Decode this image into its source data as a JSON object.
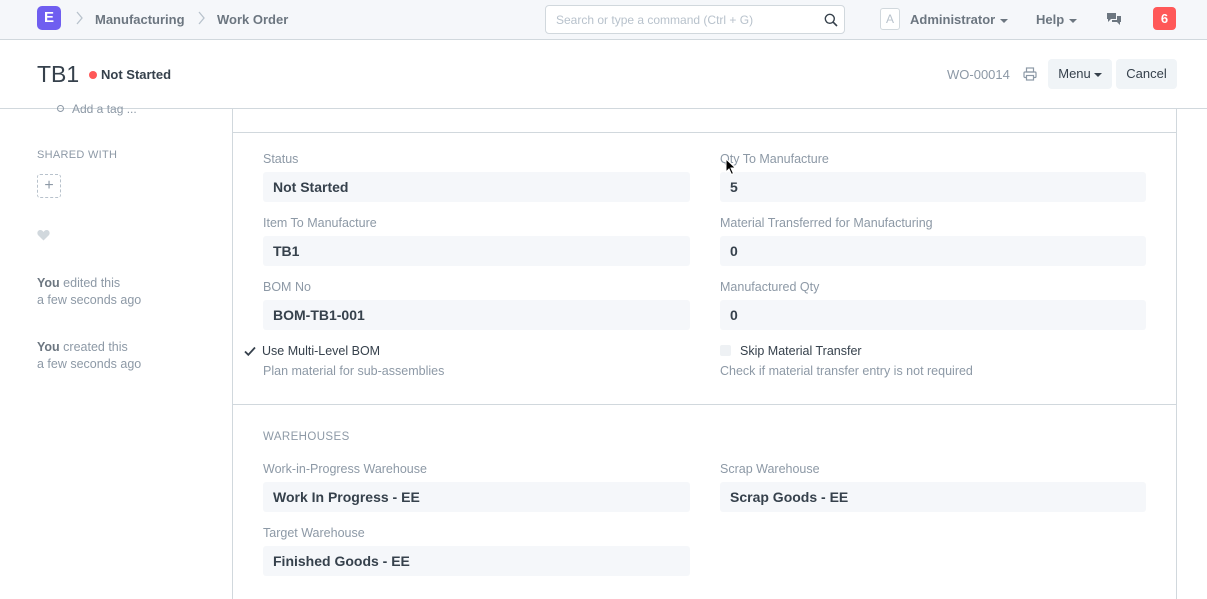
{
  "app": {
    "logo_letter": "E"
  },
  "breadcrumbs": [
    "Manufacturing",
    "Work Order"
  ],
  "search": {
    "placeholder": "Search or type a command (Ctrl + G)"
  },
  "navbar": {
    "avatar_letter": "A",
    "user_label": "Administrator",
    "help_label": "Help",
    "notification_count": "6",
    "notification_color": "#ff5858"
  },
  "page": {
    "title": "TB1",
    "status": "Not Started",
    "status_color": "#ff5858",
    "doc_id": "WO-00014",
    "menu_label": "Menu",
    "cancel_label": "Cancel"
  },
  "sidebar": {
    "add_tag_label": "Add a tag ...",
    "shared_with_label": "SHARED WITH",
    "add_share_symbol": "+",
    "activity": [
      {
        "who": "You",
        "action": "edited this",
        "when": "a few seconds ago"
      },
      {
        "who": "You",
        "action": "created this",
        "when": "a few seconds ago"
      }
    ]
  },
  "form": {
    "fields": {
      "status": {
        "label": "Status",
        "value": "Not Started"
      },
      "qty_to_manufacture": {
        "label": "Qty To Manufacture",
        "value": "5"
      },
      "item_to_manufacture": {
        "label": "Item To Manufacture",
        "value": "TB1"
      },
      "material_transferred": {
        "label": "Material Transferred for Manufacturing",
        "value": "0"
      },
      "bom_no": {
        "label": "BOM No",
        "value": "BOM-TB1-001"
      },
      "manufactured_qty": {
        "label": "Manufactured Qty",
        "value": "0"
      }
    },
    "use_multi_level_bom": {
      "label": "Use Multi-Level BOM",
      "checked": true,
      "help": "Plan material for sub-assemblies"
    },
    "skip_material_transfer": {
      "label": "Skip Material Transfer",
      "checked": false,
      "help": "Check if material transfer entry is not required"
    },
    "warehouses": {
      "section_label": "WAREHOUSES",
      "wip": {
        "label": "Work-in-Progress Warehouse",
        "value": "Work In Progress - EE"
      },
      "scrap": {
        "label": "Scrap Warehouse",
        "value": "Scrap Goods - EE"
      },
      "target": {
        "label": "Target Warehouse",
        "value": "Finished Goods - EE"
      }
    }
  }
}
